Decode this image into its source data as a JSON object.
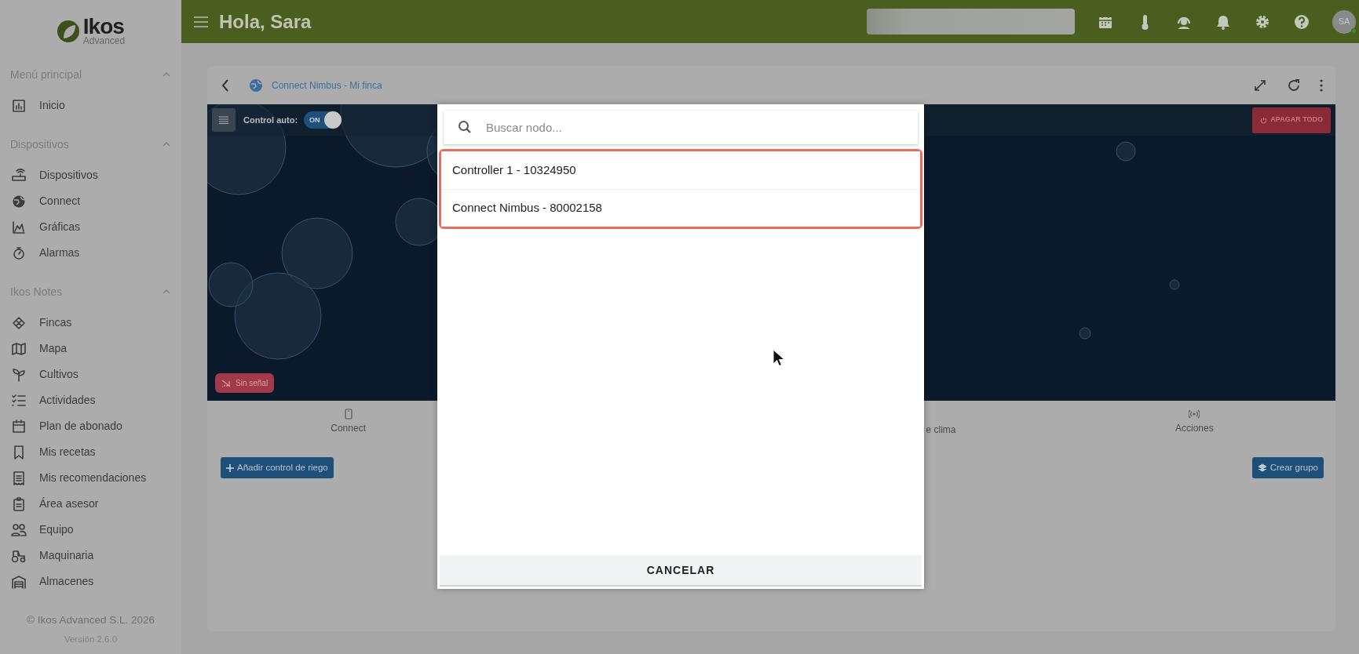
{
  "header": {
    "title": "Hola, Sara",
    "avatar": "SA"
  },
  "logo": {
    "name": "Ikos",
    "subtitle": "Advanced"
  },
  "sidebar": {
    "sections": [
      {
        "title": "Menú principal",
        "expanded": true,
        "items": [
          {
            "label": "Inicio"
          }
        ]
      },
      {
        "title": "Dispositivos",
        "expanded": true,
        "items": [
          {
            "label": "Dispositivos"
          },
          {
            "label": "Connect"
          },
          {
            "label": "Gráficas"
          },
          {
            "label": "Alarmas"
          }
        ]
      },
      {
        "title": "Ikos Notes",
        "expanded": true,
        "items": [
          {
            "label": "Fincas"
          },
          {
            "label": "Mapa"
          },
          {
            "label": "Cultivos"
          },
          {
            "label": "Actividades"
          },
          {
            "label": "Plan de abonado"
          },
          {
            "label": "Mis recetas"
          },
          {
            "label": "Mis recomendaciones"
          },
          {
            "label": "Área asesor"
          },
          {
            "label": "Equipo"
          },
          {
            "label": "Maquinaria"
          },
          {
            "label": "Almacenes"
          }
        ]
      }
    ]
  },
  "footer": {
    "copyright": "© Ikos Advanced S.L. 2026",
    "version": "Versión 2.6.0"
  },
  "card": {
    "breadcrumb": "Connect Nimbus - Mi finca",
    "control_label": "Control auto:",
    "toggle": {
      "label": "ON",
      "on": true
    },
    "off_all": "APAGAR TODO",
    "signal_badge": "Sin señal",
    "tabs": [
      {
        "label": "Connect"
      },
      {
        "label": "e clima"
      },
      {
        "label": "Acciones"
      }
    ],
    "add_button": "Añadir control de riego",
    "group_button": "Crear grupo"
  },
  "dialog": {
    "search": {
      "placeholder": "Buscar nodo..."
    },
    "nodes": [
      {
        "label": "Controller 1 - 10324950"
      },
      {
        "label": "Connect Nimbus - 80002158"
      }
    ],
    "cancel": "CANCELAR"
  }
}
